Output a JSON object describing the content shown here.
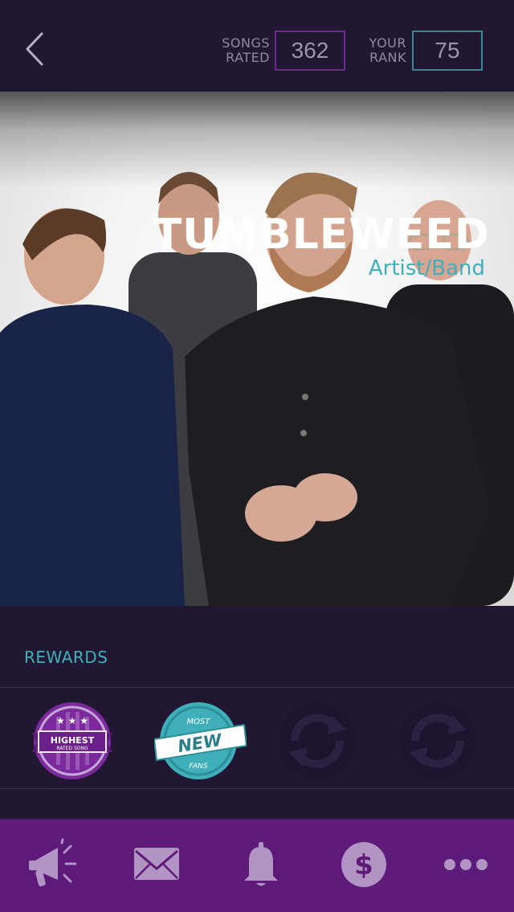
{
  "header": {
    "songs_rated_label_1": "SONGS",
    "songs_rated_label_2": "RATED",
    "songs_rated_value": "362",
    "rank_label_1": "YOUR",
    "rank_label_2": "RANK",
    "rank_value": "75"
  },
  "artist": {
    "name": "TUMBLEWEED",
    "type": "Artist/Band"
  },
  "rewards": {
    "title": "REWARDS",
    "badges": [
      {
        "line1": "HIGHEST",
        "line2": "RATED SONG",
        "state": "earned",
        "color": "#7a2a9a"
      },
      {
        "line1": "MOST",
        "line2": "NEW",
        "line3": "FANS",
        "state": "earned",
        "color": "#3fb0b9"
      },
      {
        "state": "locked",
        "icon": "refresh-icon"
      },
      {
        "state": "locked",
        "icon": "refresh-icon"
      }
    ]
  },
  "tabbar": {
    "items": [
      {
        "icon": "megaphone-icon"
      },
      {
        "icon": "mail-icon"
      },
      {
        "icon": "bell-icon"
      },
      {
        "icon": "dollar-icon"
      },
      {
        "icon": "more-icon"
      }
    ]
  },
  "colors": {
    "background": "#221733",
    "accent_teal": "#3fb0b9",
    "accent_purple": "#6d2a8a",
    "tabbar": "#5d1a78"
  }
}
